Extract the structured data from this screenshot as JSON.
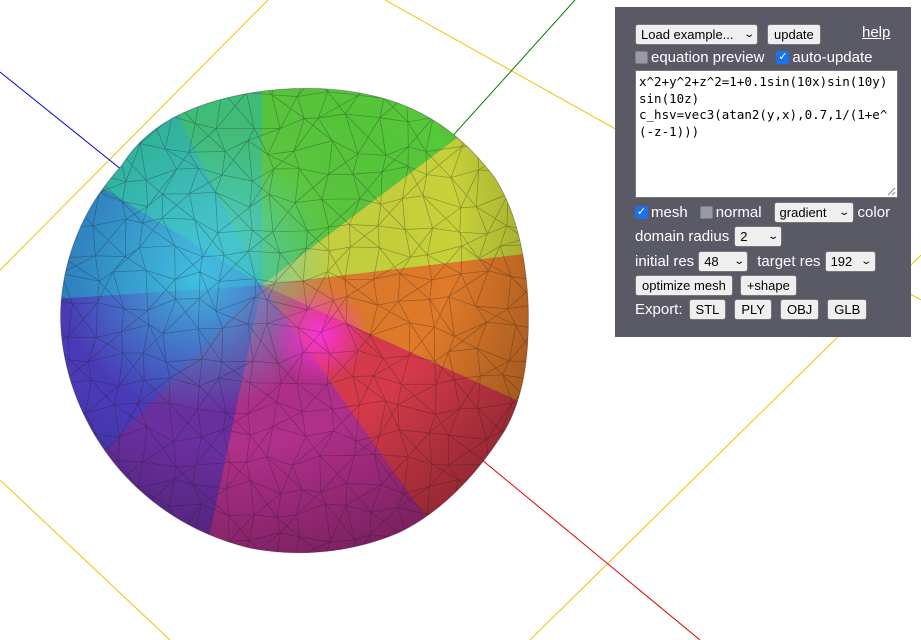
{
  "panel": {
    "example_select": "Load example...",
    "update_label": "update",
    "help_label": "help",
    "equation_preview_label": "equation preview",
    "equation_preview_checked": false,
    "auto_update_label": "auto-update",
    "auto_update_checked": true,
    "equation": "x^2+y^2+z^2=1+0.1sin(10x)sin(10y)sin(10z)\nc_hsv=vec3(atan2(y,x),0.7,1/(1+e^(-z-1)))",
    "mesh_label": "mesh",
    "mesh_checked": true,
    "normal_label": "normal",
    "normal_checked": false,
    "color_mode_select": "gradient",
    "color_label": "color",
    "domain_radius_label": "domain radius",
    "domain_radius_value": "2",
    "initial_res_label": "initial res",
    "initial_res_value": "48",
    "target_res_label": "target res",
    "target_res_value": "192",
    "optimize_label": "optimize mesh",
    "add_shape_label": "+shape",
    "export_label": "Export:",
    "export_buttons": [
      "STL",
      "PLY",
      "OBJ",
      "GLB"
    ]
  },
  "colors": {
    "panel_bg": "#5a5a66",
    "axis_x": "#e00000",
    "axis_y": "#008000",
    "axis_z": "#0000e0",
    "grid": "#f2c200"
  }
}
